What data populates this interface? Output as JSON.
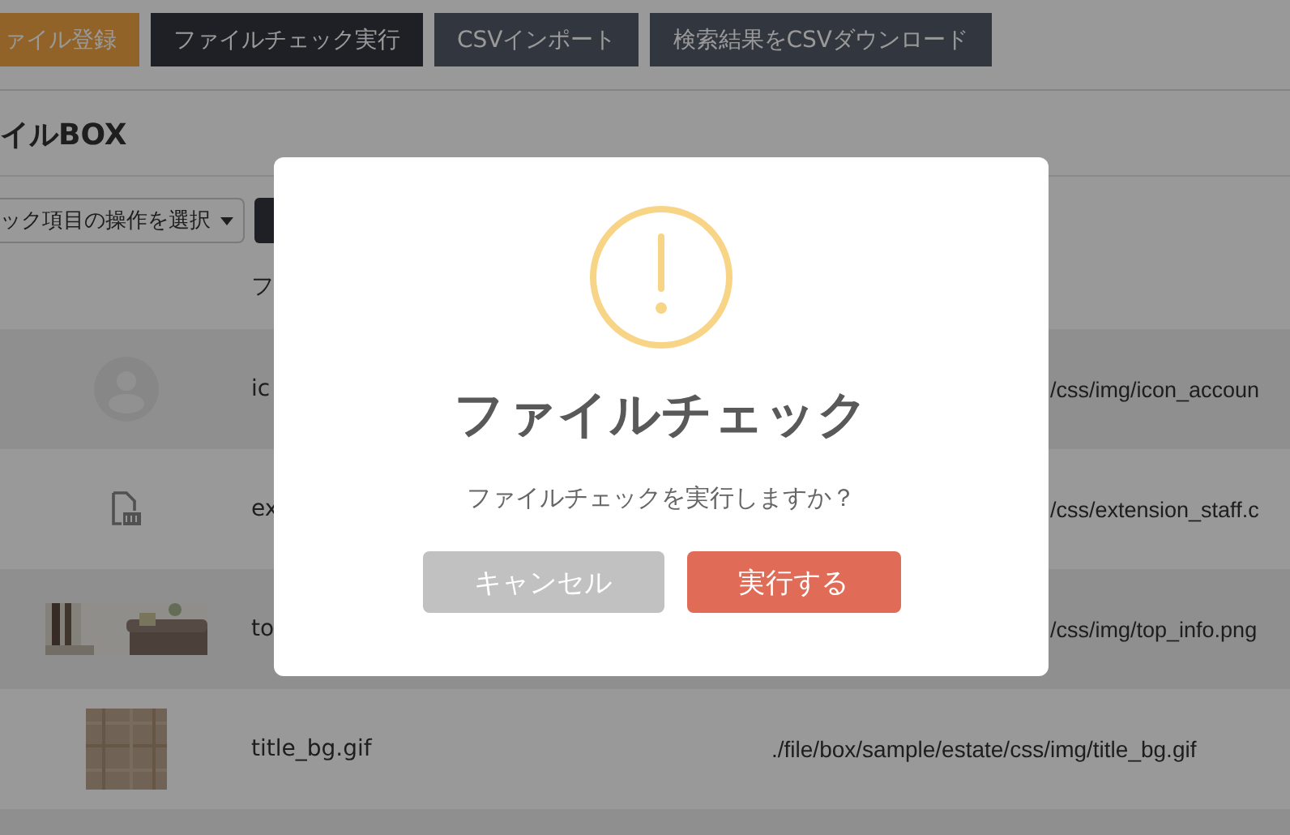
{
  "top_buttons": [
    {
      "label": "ァイル登録",
      "kind": "accent"
    },
    {
      "label": "ファイルチェック実行",
      "kind": "active"
    },
    {
      "label": "CSVインポート",
      "kind": "dark"
    },
    {
      "label": "検索結果をCSVダウンロード",
      "kind": "dark"
    }
  ],
  "heading": "イルBOX",
  "bulk_action_select": {
    "value": "ック項目の操作を選択"
  },
  "table": {
    "columns": [
      "フ"
    ],
    "rows": [
      {
        "kind": "avatar",
        "name": "ic",
        "path": "/css/img/icon_accoun",
        "covered": true
      },
      {
        "kind": "css",
        "name": "ex",
        "path": "/css/extension_staff.c",
        "covered": true
      },
      {
        "name": "to",
        "path": "/css/img/top_info.png",
        "covered": true
      },
      {
        "kind": "texture",
        "name": "title_bg.gif",
        "path": "./file/box/sample/estate/css/img/title_bg.gif",
        "covered": false
      }
    ]
  },
  "dialog": {
    "title": "ファイルチェック",
    "message": "ファイルチェックを実行しますか？",
    "buttons": [
      {
        "label": "キャンセル",
        "kind": "cancel"
      },
      {
        "label": "実行する",
        "kind": "confirm"
      }
    ]
  }
}
